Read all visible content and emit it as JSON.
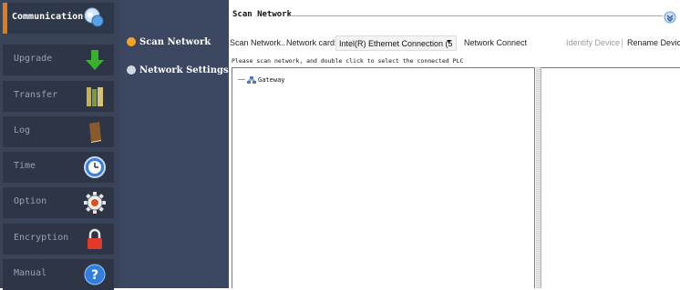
{
  "sidebar": {
    "items": [
      {
        "label": "Communication",
        "icon": "network-icon",
        "active": true
      },
      {
        "label": "Upgrade",
        "icon": "download-arrow-icon"
      },
      {
        "label": "Transfer",
        "icon": "binders-icon"
      },
      {
        "label": "Log",
        "icon": "book-icon"
      },
      {
        "label": "Time",
        "icon": "clock-icon"
      },
      {
        "label": "Option",
        "icon": "gear-icon"
      },
      {
        "label": "Encryption",
        "icon": "lock-icon"
      },
      {
        "label": "Manual",
        "icon": "help-icon"
      }
    ]
  },
  "subnav": {
    "items": [
      {
        "label": "Scan Network",
        "active": true,
        "dot_color": "#f5a623"
      },
      {
        "label": "Network Settings",
        "active": false,
        "dot_color": "#d2d6e0"
      }
    ]
  },
  "main": {
    "group_title": "Scan Network",
    "toolbar": {
      "scan_label": "Scan Network..",
      "card_label": "Network card:",
      "card_value": "Intel(R) Ethernet Connection (5",
      "connect_label": "Network Connect",
      "identify_label": "Identify Device",
      "rename_label": "Rename Device"
    },
    "hint": "Please scan network, and double click to select the connected PLC",
    "tree": {
      "root_label": "Gateway"
    }
  },
  "colors": {
    "accent": "#e07b19",
    "sidebar_bg": "#3a4459",
    "subnav_bg": "#3b4660"
  }
}
